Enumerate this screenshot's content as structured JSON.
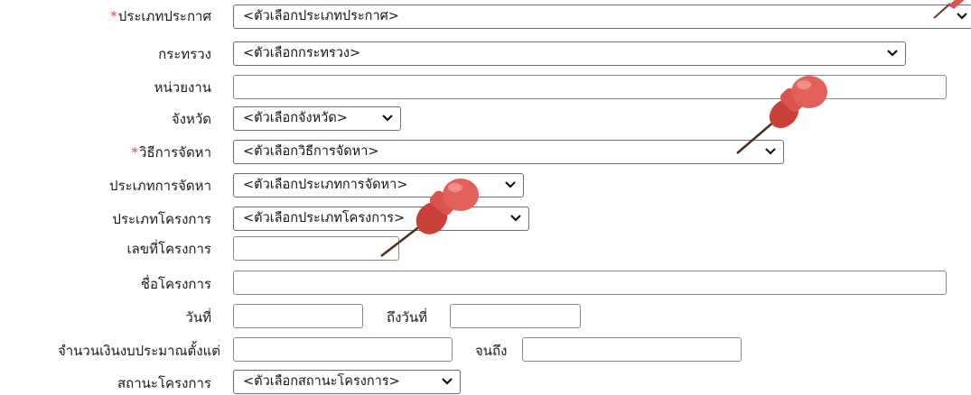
{
  "form": {
    "announcement_type": {
      "label": "ประเภทประกาศ",
      "required_mark": "*",
      "value": "<ตัวเลือกประเภทประกาศ>"
    },
    "ministry": {
      "label": "กระทรวง",
      "value": "<ตัวเลือกกระทรวง>"
    },
    "agency": {
      "label": "หน่วยงาน",
      "value": ""
    },
    "province": {
      "label": "จังหวัด",
      "value": "<ตัวเลือกจังหวัด>"
    },
    "procurement_method": {
      "label": "วิธีการจัดหา",
      "required_mark": "*",
      "value": "<ตัวเลือกวิธีการจัดหา>"
    },
    "procurement_type": {
      "label": "ประเภทการจัดหา",
      "value": "<ตัวเลือกประเภทการจัดหา>"
    },
    "project_type": {
      "label": "ประเภทโครงการ",
      "value": "<ตัวเลือกประเภทโครงการ>"
    },
    "project_number": {
      "label": "เลขที่โครงการ",
      "value": ""
    },
    "project_name": {
      "label": "ชื่อโครงการ",
      "value": ""
    },
    "date_from": {
      "label": "วันที่",
      "value": ""
    },
    "date_to": {
      "label": "ถึงวันที่",
      "value": ""
    },
    "budget_from": {
      "label": "จำนวนเงินงบประมาณตั้งแต่",
      "value": ""
    },
    "budget_to": {
      "label": "จนถึง",
      "value": ""
    },
    "project_status": {
      "label": "สถานะโครงการ",
      "value": "<ตัวเลือกสถานะโครงการ>"
    }
  },
  "colors": {
    "required": "#e0483c",
    "pin": "#d9534f"
  },
  "icons": [
    "chevron-down-icon",
    "pushpin-icon"
  ]
}
